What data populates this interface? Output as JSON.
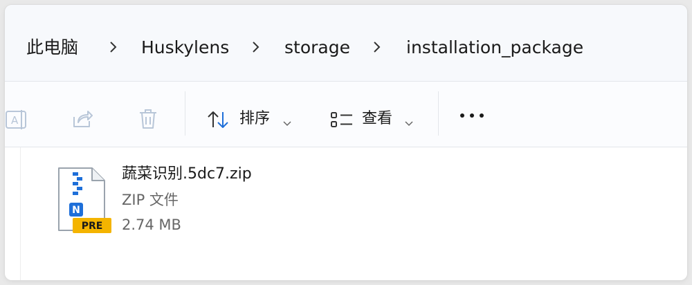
{
  "breadcrumb": {
    "items": [
      {
        "label": "此电脑"
      },
      {
        "label": "Huskylens"
      },
      {
        "label": "storage"
      },
      {
        "label": "installation_package"
      }
    ]
  },
  "toolbar": {
    "rename_icon": "rename-icon",
    "share_icon": "share-icon",
    "delete_icon": "delete-icon",
    "sort_label": "排序",
    "view_label": "查看",
    "more_icon": "more-icon",
    "disabled_color": "#b8c6d8"
  },
  "file": {
    "name": "蔬菜识别.5dc7.zip",
    "type": "ZIP 文件",
    "size": "2.74 MB",
    "badge": "PRE",
    "badge_color": "#f4b400",
    "icon_letter": "N",
    "icon_color": "#1e6fd9"
  }
}
